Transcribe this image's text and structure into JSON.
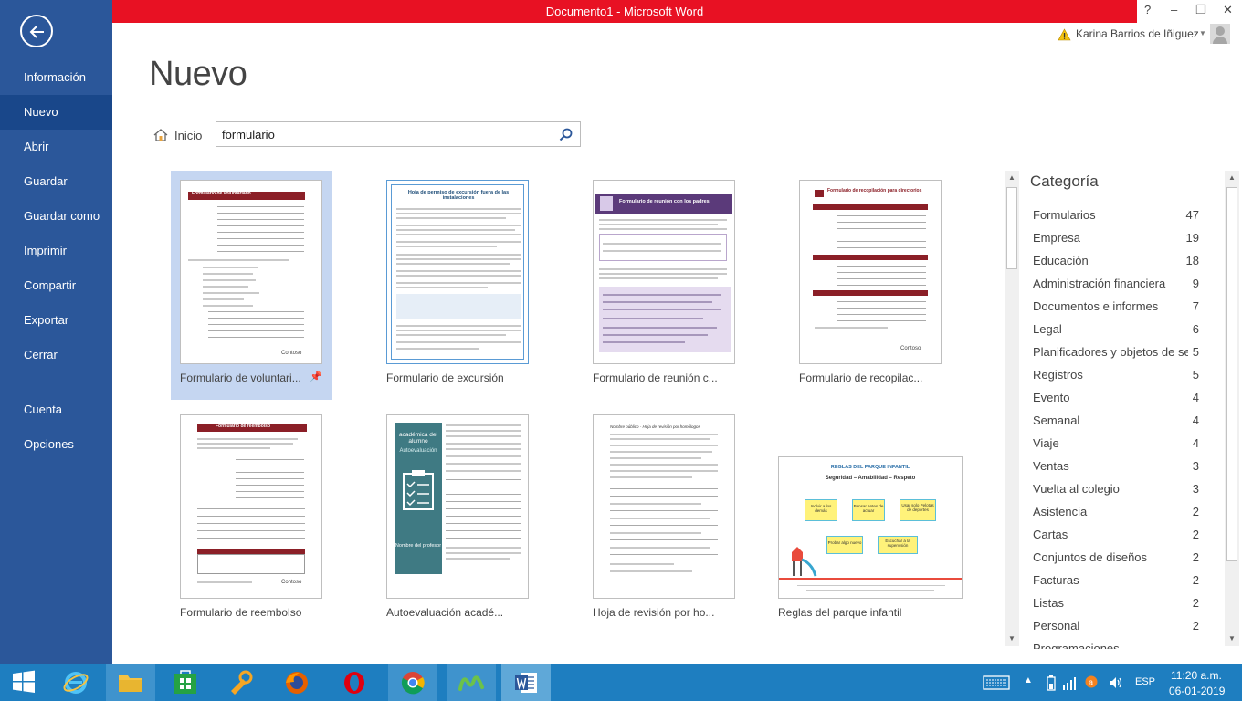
{
  "window": {
    "title": "Documento1 - Microsoft Word",
    "help_label": "?",
    "minimize_label": "–",
    "restore_label": "❐",
    "close_label": "✕"
  },
  "account": {
    "name": "Karina Barrios de Iñiguez"
  },
  "sidebar": {
    "items": [
      {
        "label": "Información"
      },
      {
        "label": "Nuevo"
      },
      {
        "label": "Abrir"
      },
      {
        "label": "Guardar"
      },
      {
        "label": "Guardar como"
      },
      {
        "label": "Imprimir"
      },
      {
        "label": "Compartir"
      },
      {
        "label": "Exportar"
      },
      {
        "label": "Cerrar"
      },
      {
        "label": "Cuenta"
      },
      {
        "label": "Opciones"
      }
    ],
    "active": "Nuevo",
    "accent_color": "#2b579a"
  },
  "main": {
    "title": "Nuevo",
    "home_label": "Inicio",
    "search": {
      "value": "formulario"
    }
  },
  "templates": [
    {
      "label": "Formulario de voluntari...",
      "thumb_title": "Formulario de voluntariado",
      "thumb_brand": "Contoso"
    },
    {
      "label": "Formulario de excursión",
      "thumb_title": "Hoja de permiso de excursión fuera de las instalaciones"
    },
    {
      "label": "Formulario de reunión c...",
      "thumb_title": "Formulario de reunión con los padres"
    },
    {
      "label": "Formulario de recopilac...",
      "thumb_title": "Formulario de recopilación para directorios",
      "thumb_brand": "Contoso"
    },
    {
      "label": "Formulario de reembolso",
      "thumb_title": "Formulario de reembolso",
      "thumb_brand": "Contoso"
    },
    {
      "label": "Autoevaluación acadé...",
      "thumb_title": "académica del alumno",
      "thumb_sub": "Autoevaluación",
      "thumb_footer": "Nombre del profesor"
    },
    {
      "label": "Hoja de revisión por ho...",
      "thumb_title": "Nombre público - Hoja de revisión por homólogos"
    },
    {
      "label": "Reglas del parque infantil",
      "thumb_title": "REGLAS DEL PARQUE INFANTIL",
      "thumb_sub": "Seguridad – Amabilidad – Respeto",
      "boxes": [
        "Incluir a los demás",
        "Pensar antes de actuar",
        "Usar solo Pelotas de deportes",
        "Probar algo nuevo",
        "Escuchar a la supervisión"
      ]
    }
  ],
  "categories": {
    "heading": "Categoría",
    "items": [
      {
        "name": "Formularios",
        "count": "47"
      },
      {
        "name": "Empresa",
        "count": "19"
      },
      {
        "name": "Educación",
        "count": "18"
      },
      {
        "name": "Administración financiera",
        "count": "9"
      },
      {
        "name": "Documentos e informes",
        "count": "7"
      },
      {
        "name": "Legal",
        "count": "6"
      },
      {
        "name": "Planificadores y objetos de se...",
        "count": "5"
      },
      {
        "name": "Registros",
        "count": "5"
      },
      {
        "name": "Evento",
        "count": "4"
      },
      {
        "name": "Semanal",
        "count": "4"
      },
      {
        "name": "Viaje",
        "count": "4"
      },
      {
        "name": "Ventas",
        "count": "3"
      },
      {
        "name": "Vuelta al colegio",
        "count": "3"
      },
      {
        "name": "Asistencia",
        "count": "2"
      },
      {
        "name": "Cartas",
        "count": "2"
      },
      {
        "name": "Conjuntos de diseños",
        "count": "2"
      },
      {
        "name": "Facturas",
        "count": "2"
      },
      {
        "name": "Listas",
        "count": "2"
      },
      {
        "name": "Personal",
        "count": "2"
      },
      {
        "name": "Programaciones",
        "count": ""
      }
    ]
  },
  "taskbar": {
    "apps": [
      "start",
      "internet-explorer",
      "file-explorer",
      "store",
      "app-tools",
      "firefox",
      "opera",
      "chrome",
      "movistar",
      "word"
    ],
    "language": "ESP",
    "time": "11:20 a.m.",
    "date": "06-01-2019"
  }
}
